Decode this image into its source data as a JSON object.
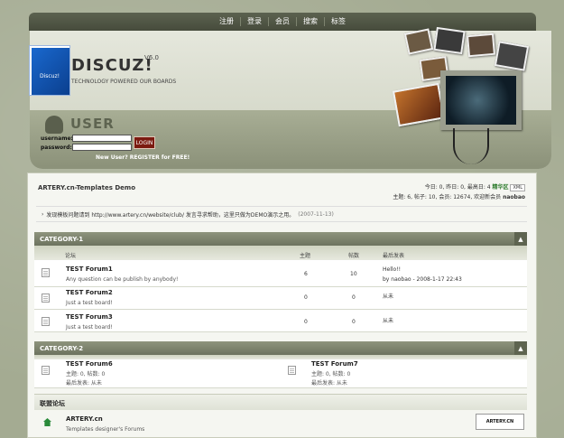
{
  "nav": {
    "items": [
      "注册",
      "登录",
      "会员",
      "搜索",
      "标签"
    ]
  },
  "header": {
    "logo_box_text": "Discuz!",
    "logo_title": "DISCUZ!",
    "version": "V6.0",
    "tagline": "TECHNOLOGY POWERED OUR BOARDS"
  },
  "login": {
    "title": "USER",
    "username_label": "username:",
    "password_label": "password:",
    "button": "LOGIN",
    "register": "New User? REGISTER for FREE!"
  },
  "breadcrumb": "ARTERY.cn-Templates Demo",
  "stats": {
    "line1_prefix": "今日: 0, 昨日: 0, 最高日: 4",
    "line1_highlight": "精华区",
    "line1_badge": "XML",
    "line2": "主题: 6, 帖子: 10, 会员: 12674, 欢迎新会员",
    "newest_member": "naobao"
  },
  "notice": {
    "text": "发现模板问题请到  http://www.artery.cn/website/club/ 发言寻求帮助，这里只做为DEMO演示之用。",
    "date": "(2007-11-13)"
  },
  "category1": {
    "title": "CATEGORY-1",
    "headers": {
      "forum": "论坛",
      "topics": "主题",
      "posts": "帖数",
      "last": "最后发表"
    },
    "forums": [
      {
        "name": "TEST Forum1",
        "desc": "Any question can be publish by anybody!",
        "topics": "6",
        "posts": "10",
        "last_title": "Hello!!",
        "last_meta": "by naobao - 2008-1-17 22:43"
      },
      {
        "name": "TEST Forum2",
        "desc": "Just a test board!",
        "topics": "0",
        "posts": "0",
        "last_title": "从未",
        "last_meta": ""
      },
      {
        "name": "TEST Forum3",
        "desc": "Just a test board!",
        "topics": "0",
        "posts": "0",
        "last_title": "从未",
        "last_meta": ""
      }
    ]
  },
  "category2": {
    "title": "CATEGORY-2",
    "forums": [
      {
        "name": "TEST Forum6",
        "stats": "主题: 0, 帖数: 0",
        "last": "最后发表: 从未"
      },
      {
        "name": "TEST Forum7",
        "stats": "主题: 0, 帖数: 0",
        "last": "最后发表: 从未"
      }
    ]
  },
  "links": {
    "title": "联盟论坛",
    "site_name": "ARTERY.cn",
    "site_desc": "Templates designer's Forums",
    "logo_text": "ARTERY.CN"
  }
}
